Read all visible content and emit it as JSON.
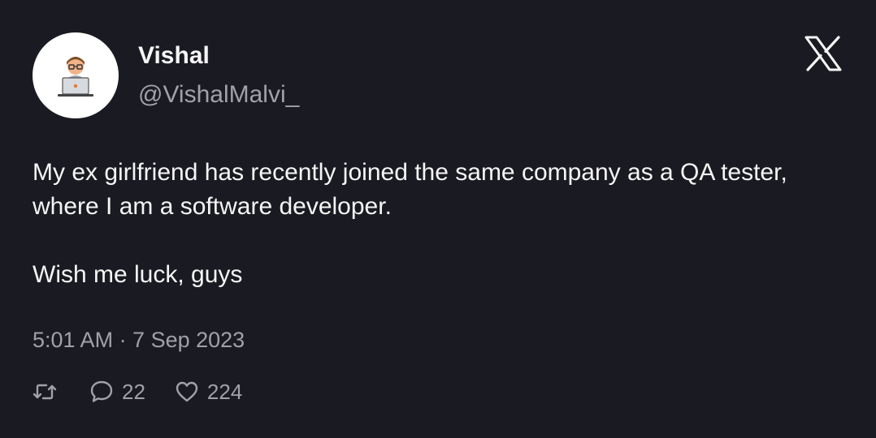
{
  "author": {
    "name": "Vishal",
    "handle": "@VishalMalvi_",
    "avatar_icon": "developer-avatar-icon"
  },
  "brand": {
    "icon": "x-logo-icon"
  },
  "tweet": {
    "line1": "My ex girlfriend has recently joined the same company as a QA tester, where I am a software developer.",
    "line2": "Wish me luck, guys",
    "timestamp": "5:01 AM · 7 Sep 2023"
  },
  "actions": {
    "retweet_icon": "retweet-icon",
    "reply_icon": "reply-icon",
    "reply_count": "22",
    "like_icon": "heart-icon",
    "like_count": "224"
  },
  "colors": {
    "background": "#1a1a22",
    "text": "#f5f5f5",
    "muted": "#a1a1aa"
  }
}
